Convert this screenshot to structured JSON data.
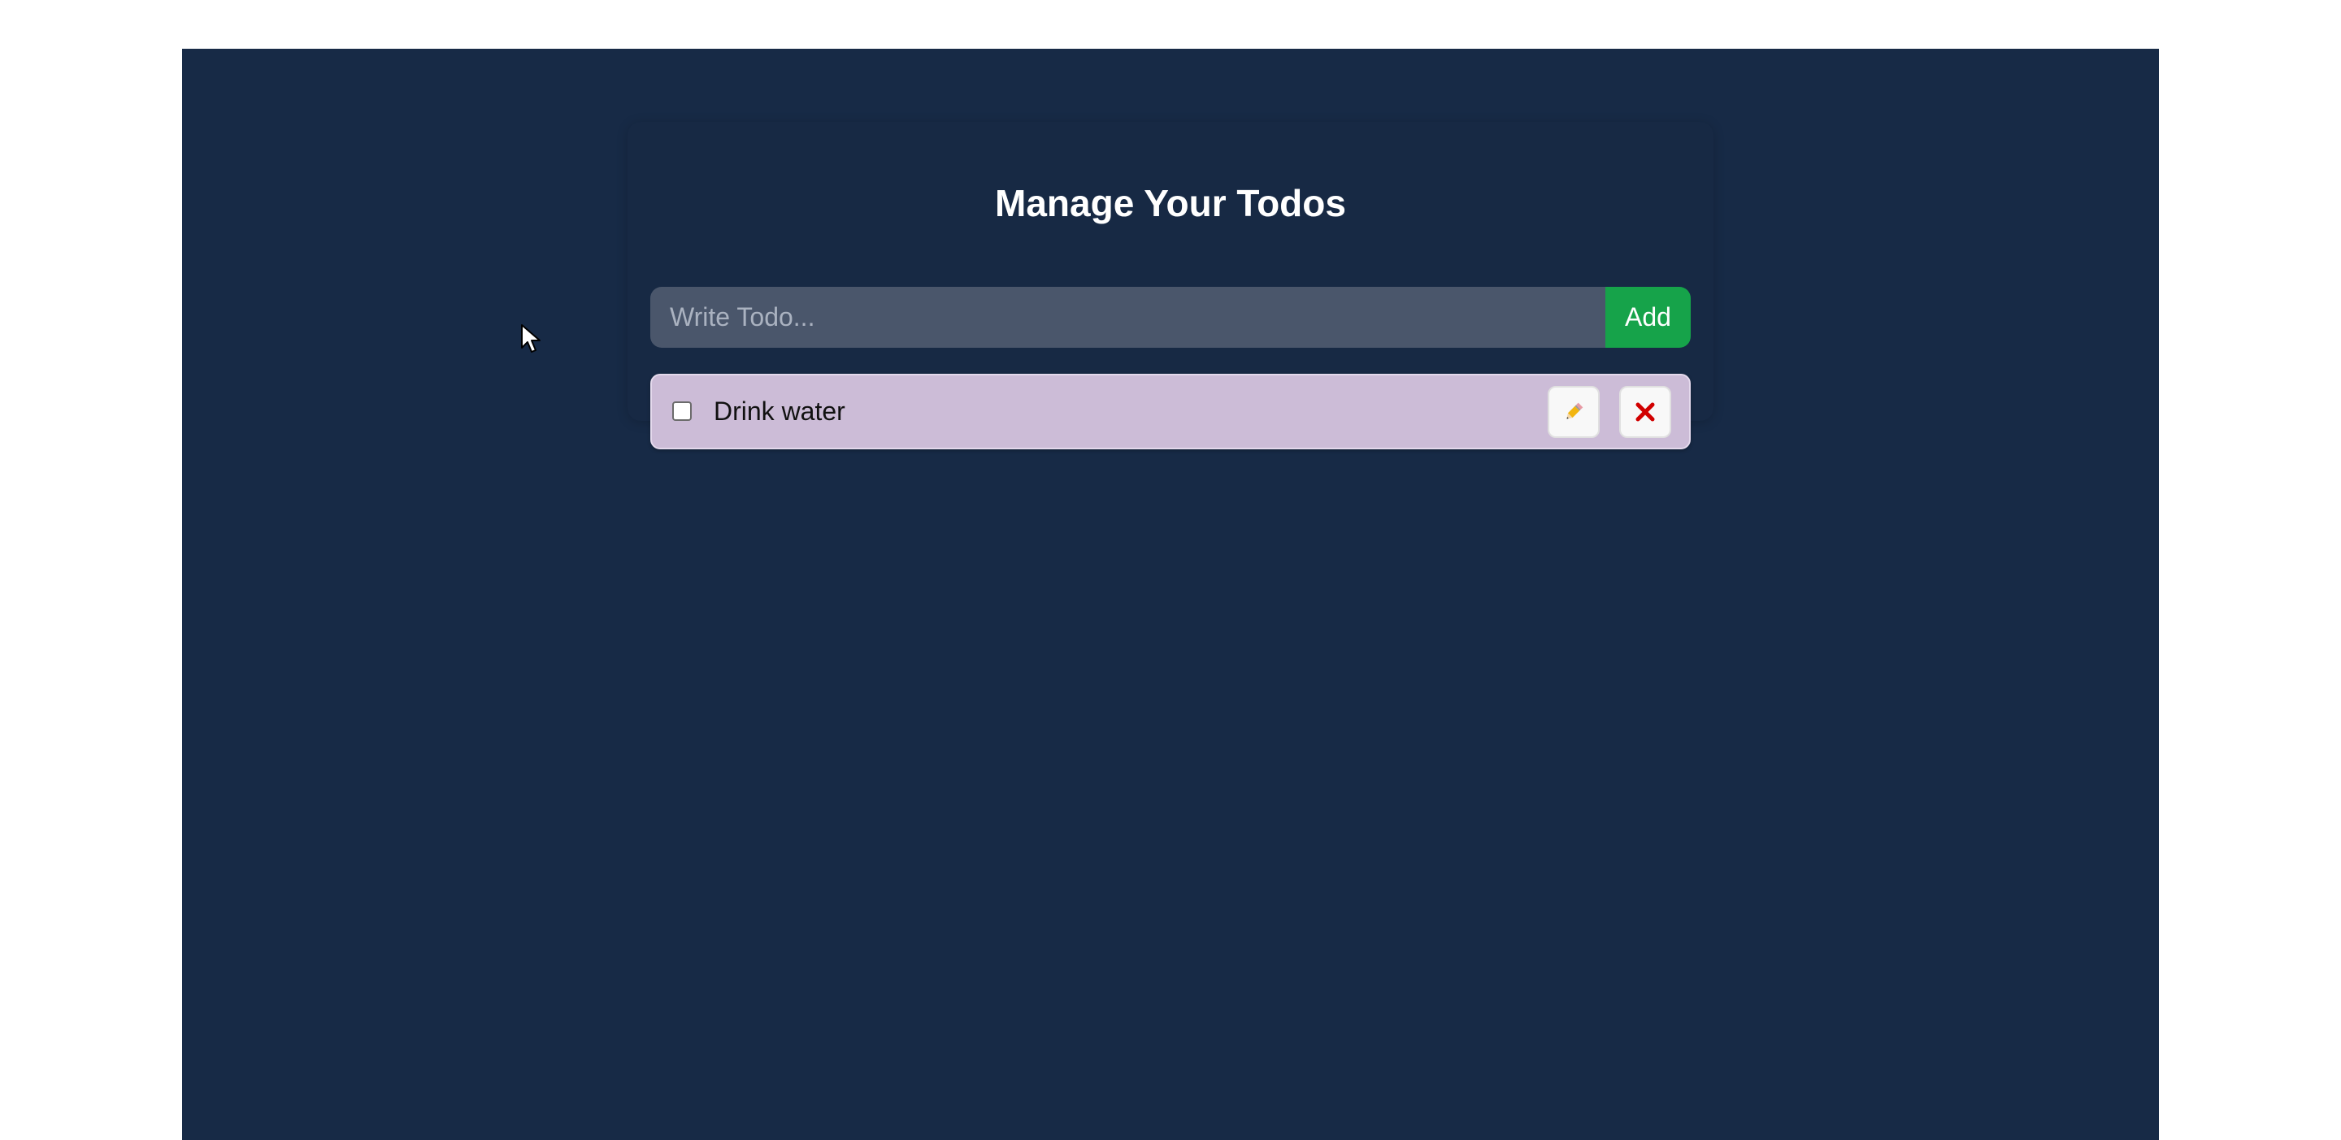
{
  "app": {
    "title": "Manage Your Todos"
  },
  "input": {
    "placeholder": "Write Todo...",
    "value": ""
  },
  "add_button": {
    "label": "Add",
    "color": "#16a34a"
  },
  "todos": [
    {
      "text": "Drink water",
      "completed": false,
      "background": "#ccbcd7",
      "edit_icon": "pencil-icon",
      "delete_icon": "close-icon"
    }
  ],
  "colors": {
    "page_background": "#172a46",
    "input_background": "#4a566b",
    "delete_icon": "#d10000"
  }
}
